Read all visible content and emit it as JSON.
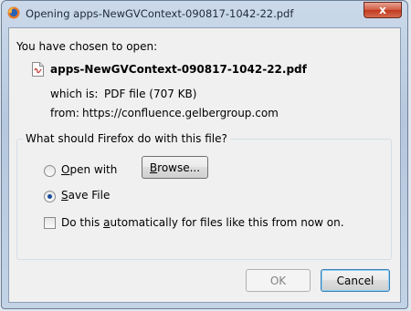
{
  "window": {
    "title": "Opening apps-NewGVContext-090817-1042-22.pdf",
    "close_glyph": "x"
  },
  "dialog": {
    "intro": "You have chosen to open:",
    "filename": "apps-NewGVContext-090817-1042-22.pdf",
    "which_is_label": "which is:",
    "which_is_value": "PDF file (707 KB)",
    "from_label": "from:",
    "from_value": "https://confluence.gelbergroup.com",
    "group_title": "What should Firefox do with this file?",
    "open_with_label_accel": "O",
    "open_with_label_rest": "pen with",
    "browse_accel": "B",
    "browse_rest": "rowse...",
    "save_file_accel": "S",
    "save_file_rest": "ave File",
    "auto_label_pre": "Do this ",
    "auto_label_accel": "a",
    "auto_label_post": "utomatically for files like this from now on.",
    "ok_label": "OK",
    "cancel_label": "Cancel",
    "selected_option": "save_file",
    "auto_checked": false
  }
}
